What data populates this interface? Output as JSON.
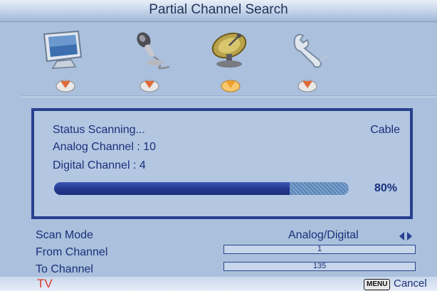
{
  "header": {
    "title": "Partial Channel Search"
  },
  "menu_icons": [
    {
      "icon": "tv-monitor-icon"
    },
    {
      "icon": "microphone-icon"
    },
    {
      "icon": "satellite-dish-icon"
    },
    {
      "icon": "wrench-icon"
    }
  ],
  "status": {
    "status_text": "Status Scanning...",
    "source": "Cable",
    "analog_text": "Analog Channel : 10",
    "digital_text": "Digital Channel : 4",
    "progress_percent_text": "80%",
    "progress_fraction": 0.8
  },
  "settings": {
    "scan_mode_label": "Scan Mode",
    "scan_mode_value": "Analog/Digital",
    "from_channel_label": "From Channel",
    "from_channel_value": "1",
    "to_channel_label": "To Channel",
    "to_channel_value": "135"
  },
  "footer": {
    "brand": "TV",
    "menu_key": "MENU",
    "cancel_label": "Cancel"
  },
  "colors": {
    "background": "#aac0dc",
    "accent": "#27408e",
    "text": "#1b2f7a",
    "pointer_active": "#f0a030",
    "brand": "#e0382a"
  }
}
